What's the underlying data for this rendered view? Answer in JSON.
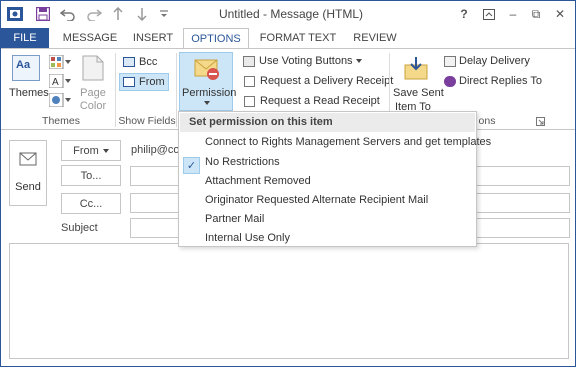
{
  "window": {
    "title": "Untitled - Message (HTML)",
    "help": "?",
    "restore": "⧉",
    "minimize": "–",
    "close": "✕"
  },
  "tabs": [
    "FILE",
    "MESSAGE",
    "INSERT",
    "OPTIONS",
    "FORMAT TEXT",
    "REVIEW"
  ],
  "ribbon": {
    "themes_label": "Themes",
    "page_color_label": "Page Color",
    "group_themes": "Themes",
    "bcc_label": "Bcc",
    "from_label": "From",
    "group_show_fields": "Show Fields",
    "permission_label": "Permission",
    "voting_label": "Use Voting Buttons",
    "delivery_receipt_label": "Request a Delivery Receipt",
    "read_receipt_label": "Request a Read Receipt",
    "save_sent_label_1": "Save Sent",
    "save_sent_label_2": "Item To",
    "delay_delivery_label": "Delay Delivery",
    "direct_replies_label": "Direct Replies To",
    "group_more_options_fragment": "ons"
  },
  "form": {
    "send_label": "Send",
    "from_button": "From",
    "from_value": "philip@co",
    "to_button": "To...",
    "cc_button": "Cc...",
    "subject_label": "Subject"
  },
  "dropdown": {
    "header": "Set permission on this item",
    "items": [
      "Connect to Rights Management Servers and get templates",
      "No Restrictions",
      "Attachment Removed",
      "Originator Requested Alternate Recipient Mail",
      "Partner Mail",
      "Internal Use Only"
    ],
    "checked_item": "No Restrictions"
  },
  "colors": {
    "accent": "#2b579a",
    "highlight": "#cde6f7"
  }
}
